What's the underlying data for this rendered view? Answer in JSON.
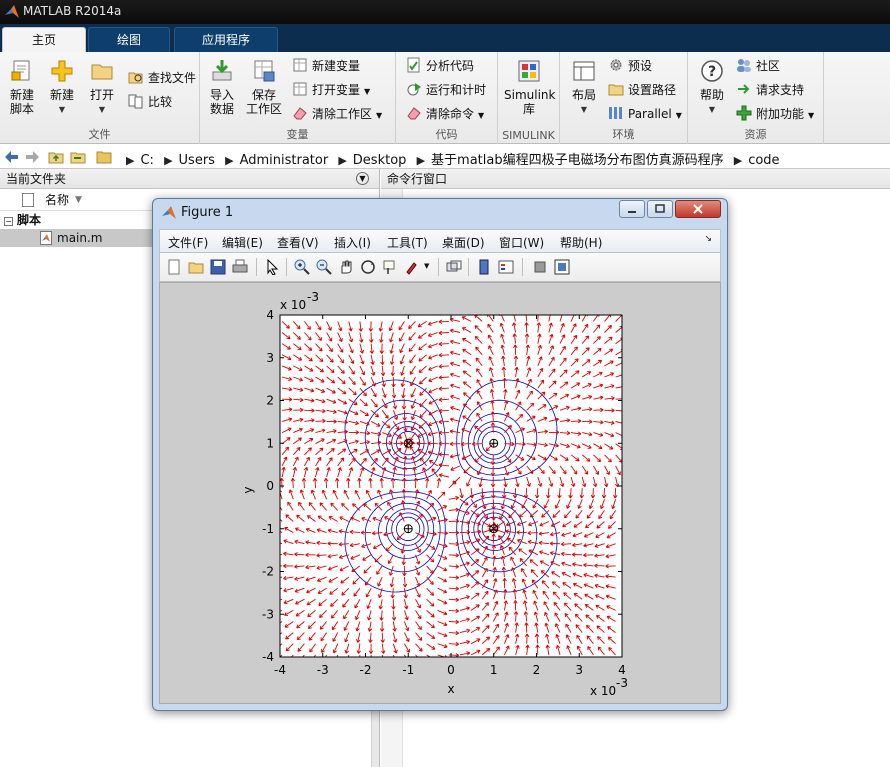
{
  "app": {
    "title": "MATLAB R2014a"
  },
  "ribbon_tabs": [
    {
      "label": "主页",
      "active": true
    },
    {
      "label": "绘图",
      "active": false
    },
    {
      "label": "应用程序",
      "active": false
    }
  ],
  "ribbon": {
    "file": {
      "label": "文件",
      "new_script": "新建\n脚本",
      "new": "新建",
      "open": "打开",
      "find_files": "查找文件",
      "compare": "比较"
    },
    "variable": {
      "label": "变量",
      "import": "导入\n数据",
      "save": "保存\n工作区",
      "new_var": "新建变量",
      "open_var": "打开变量",
      "clear_ws": "清除工作区"
    },
    "code": {
      "label": "代码",
      "analyze": "分析代码",
      "run_time": "运行和计时",
      "clear_cmd": "清除命令"
    },
    "simulink": {
      "label": "SIMULINK",
      "lib": "Simulink\n库"
    },
    "env": {
      "label": "环境",
      "layout": "布局",
      "prefs": "预设",
      "set_path": "设置路径",
      "parallel": "Parallel"
    },
    "resources": {
      "label": "资源",
      "help": "帮助",
      "community": "社区",
      "support": "请求支持",
      "addons": "附加功能"
    }
  },
  "address": {
    "crumbs": [
      "C:",
      "Users",
      "Administrator",
      "Desktop",
      "基于matlab编程四极子电磁场分布图仿真源码程序",
      "code"
    ]
  },
  "current_folder": {
    "title": "当前文件夹",
    "column_name": "名称",
    "group": "脚本",
    "file": "main.m"
  },
  "command_window": {
    "title": "命令行窗口"
  },
  "figure": {
    "title": "Figure 1",
    "menus": [
      "文件(F)",
      "编辑(E)",
      "查看(V)",
      "插入(I)",
      "工具(T)",
      "桌面(D)",
      "窗口(W)",
      "帮助(H)"
    ]
  },
  "chart_data": {
    "type": "contour+quiver",
    "xlabel": "x",
    "ylabel": "y",
    "x_exponent": "x 10",
    "x_exponent_power": "-3",
    "y_exponent": "x 10",
    "y_exponent_power": "-3",
    "xlim": [
      -4,
      4
    ],
    "ylim": [
      -4,
      4
    ],
    "xticks": [
      "-4",
      "-3",
      "-2",
      "-1",
      "0",
      "1",
      "2",
      "3",
      "4"
    ],
    "yticks": [
      "4",
      "3",
      "2",
      "1",
      "0",
      "-1",
      "-2",
      "-3",
      "-4"
    ],
    "charges": [
      {
        "x": -1,
        "y": 1,
        "sign": "negative"
      },
      {
        "x": 1,
        "y": 1,
        "sign": "positive"
      },
      {
        "x": -1,
        "y": -1,
        "sign": "positive"
      },
      {
        "x": 1,
        "y": -1,
        "sign": "negative"
      }
    ],
    "contour_color": "#0000cc",
    "arrow_color": "#dd0000",
    "axes_background": "#ffffff",
    "figure_background": "#cccccc"
  }
}
